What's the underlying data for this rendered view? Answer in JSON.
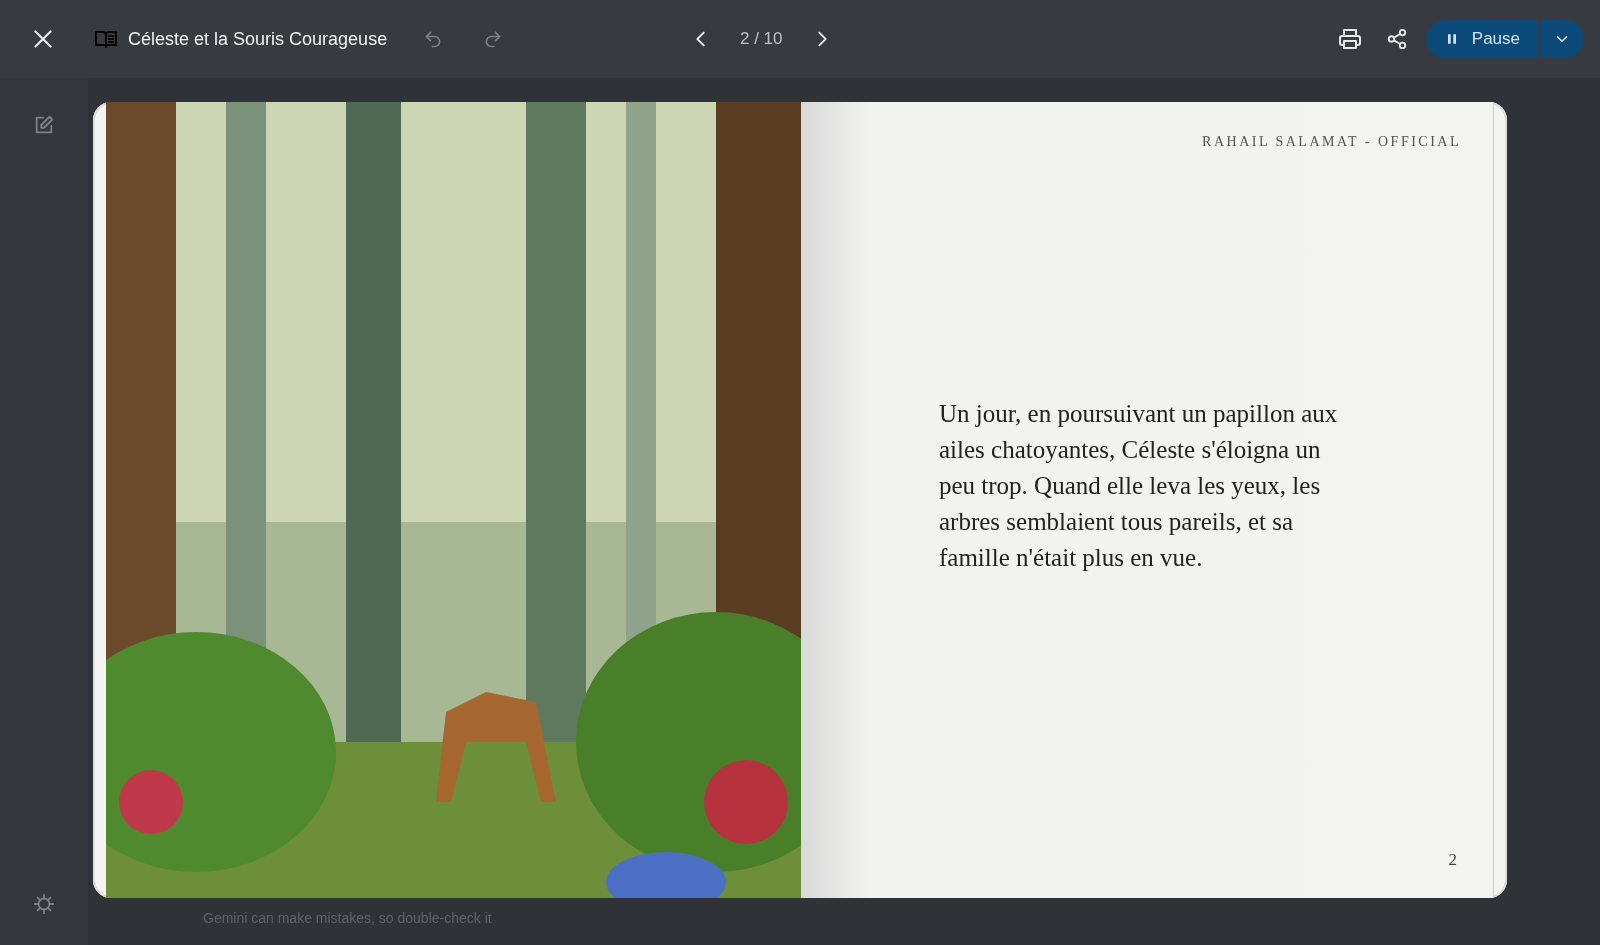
{
  "toolbar": {
    "title": "Céleste et la Souris Courageuse",
    "undo": {
      "disabled": true
    },
    "redo": {
      "disabled": true
    },
    "page_indicator": "2 / 10",
    "play_button": {
      "label": "Pause"
    }
  },
  "sidebar": {
    "edit": {
      "disabled": true
    }
  },
  "book": {
    "right_page": {
      "header": "RAHAIL SALAMAT - OFFICIAL",
      "text": "Un jour, en poursuivant un papillon aux ailes chatoyantes, Céleste s'éloigna un peu trop. Quand elle leva les yeux, les arbres semblaient tous pareils, et sa famille n'était plus en vue.",
      "page_number": "2"
    }
  },
  "footer": "Gemini can make mistakes, so double-check it"
}
